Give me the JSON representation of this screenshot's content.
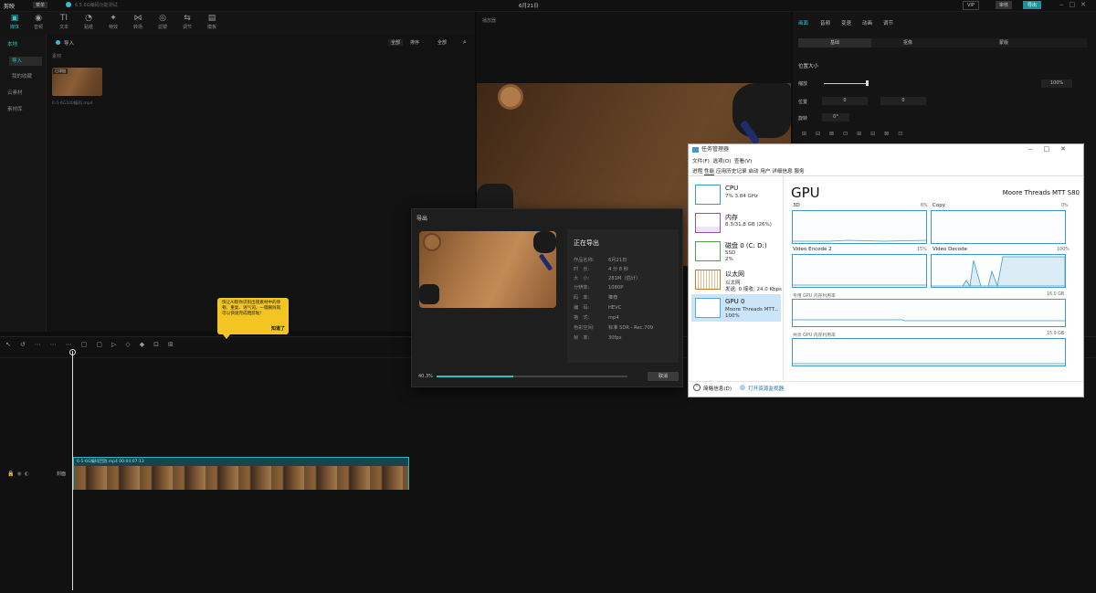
{
  "app": {
    "logo": "剪映",
    "menu": "菜单",
    "project_name": "6.5.6G编码功能测试",
    "title": "6月21日",
    "top_right": [
      "VIP",
      "审核",
      "导出"
    ]
  },
  "toolbar": {
    "items": [
      "媒体",
      "音频",
      "文本",
      "贴纸",
      "特效",
      "转场",
      "滤镜",
      "调节",
      "模板"
    ],
    "active": "媒体"
  },
  "leftnav": {
    "items": [
      "本地",
      "导入",
      "我的收藏",
      "云素材",
      "素材库"
    ]
  },
  "media": {
    "import_label": "导入",
    "filter_label": "全部",
    "sort_label": "排序",
    "view_label": "全部",
    "section_label": "素材",
    "clip_badge": "已添加",
    "clip_name": "6-5-6G100编码.mp4"
  },
  "player": {
    "title": "播放器"
  },
  "inspector": {
    "tabs": [
      "画面",
      "音频",
      "变速",
      "动画",
      "调节"
    ],
    "subtabs": [
      "基础",
      "抠像",
      "蒙版"
    ],
    "section": "位置大小",
    "scale_label": "缩放",
    "scale_value": "100%",
    "position_label": "位置",
    "position_x": "0",
    "position_y": "0",
    "rotate_label": "旋转",
    "rotate_value": "0°"
  },
  "export": {
    "title": "导出",
    "status": "正在导出",
    "rows": [
      {
        "k": "作品名称:",
        "v": "6月21日"
      },
      {
        "k": "时　长:",
        "v": "4 分 8 秒"
      },
      {
        "k": "大　小:",
        "v": "281M（估计）"
      },
      {
        "k": "分辨率:",
        "v": "1080P"
      },
      {
        "k": "码　率:",
        "v": "推荐"
      },
      {
        "k": "编　码:",
        "v": "HEVC"
      },
      {
        "k": "格　式:",
        "v": "mp4"
      },
      {
        "k": "色彩空间:",
        "v": "标准 SDR - Rec.709"
      },
      {
        "k": "帧　率:",
        "v": "30fps"
      }
    ],
    "progress_label": "40.3%",
    "progress": 0.403,
    "cancel": "取消"
  },
  "tooltip": {
    "text": "快让AI帮你识别出镜素材中的停顿、重复、语气词，一键删除就可以快速完成粗剪啦！",
    "button": "知道了"
  },
  "timeline": {
    "track_label": "封面",
    "clip_name": "6-5-6G编码回放.mp4  00:04:07:13"
  },
  "taskmgr": {
    "title": "任务管理器",
    "menu": [
      "文件(F)",
      "选项(O)",
      "查看(V)"
    ],
    "tabs": [
      "进程",
      "性能",
      "应用历史记录",
      "启动",
      "用户",
      "详细信息",
      "服务"
    ],
    "side": [
      {
        "name": "CPU",
        "l2": "7%  3.84 GHz",
        "l3": ""
      },
      {
        "name": "内存",
        "l2": "8.3/31.8 GB (26%)",
        "l3": ""
      },
      {
        "name": "磁盘 0 (C: D:)",
        "l2": "SSD",
        "l3": "2%"
      },
      {
        "name": "以太网",
        "l2": "以太网",
        "l3": "发送: 0  接收: 24.0 Kbps"
      },
      {
        "name": "GPU 0",
        "l2": "Moore Threads MTT...",
        "l3": "100%"
      }
    ],
    "gpu_title": "GPU",
    "gpu_name": "Moore Threads MTT S80",
    "graphs": [
      {
        "label": "3D",
        "pct": "6%"
      },
      {
        "label": "Copy",
        "pct": "0%"
      },
      {
        "label": "Video Encode 2",
        "pct": "15%"
      },
      {
        "label": "Video Decode",
        "pct": "100%"
      }
    ],
    "dedicated_label": "专用 GPU 内存利用率",
    "dedicated_max": "16.0 GB",
    "shared_label": "共享 GPU 内存利用率",
    "shared_max": "15.9 GB",
    "fewer_details": "简略信息(D)",
    "open_monitor": "打开资源监视器"
  },
  "colors": {
    "accent": "#2bc3c8",
    "tooltip": "#f2c523",
    "tm_graph": "#3f99c7"
  }
}
